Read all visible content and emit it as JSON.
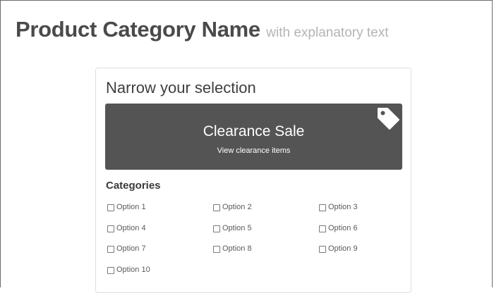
{
  "header": {
    "title": "Product Category Name",
    "subtitle": "with explanatory text"
  },
  "panel": {
    "title": "Narrow your selection",
    "promo": {
      "title": "Clearance Sale",
      "link": "View clearance items",
      "icon": "tag-icon",
      "background": "#545454"
    },
    "categories": {
      "title": "Categories",
      "options": [
        {
          "label": "Option 1",
          "checked": false
        },
        {
          "label": "Option 2",
          "checked": false
        },
        {
          "label": "Option 3",
          "checked": false
        },
        {
          "label": "Option 4",
          "checked": false
        },
        {
          "label": "Option 5",
          "checked": false
        },
        {
          "label": "Option 6",
          "checked": false
        },
        {
          "label": "Option 7",
          "checked": false
        },
        {
          "label": "Option 8",
          "checked": false
        },
        {
          "label": "Option 9",
          "checked": false
        },
        {
          "label": "Option 10",
          "checked": false
        }
      ]
    }
  }
}
